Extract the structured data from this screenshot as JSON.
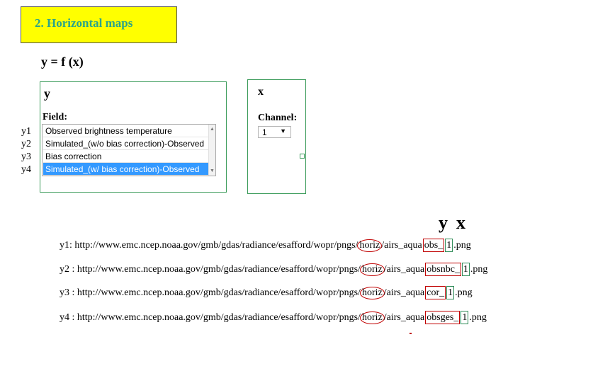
{
  "header": {
    "title": "2. Horizontal maps"
  },
  "formula": "y = f (x)",
  "y_panel": {
    "title": "y",
    "field_label": "Field:",
    "options": [
      "Observed brightness temperature",
      "Simulated_(w/o bias correction)-Observed",
      "Bias correction",
      "Simulated_(w/ bias correction)-Observed"
    ],
    "selected_index": 3,
    "row_labels": [
      "y1",
      "y2",
      "y3",
      "y4"
    ]
  },
  "x_panel": {
    "title": "x",
    "channel_label": "Channel:",
    "channel_value": "1"
  },
  "yx_labels": {
    "y": "y",
    "x": "x"
  },
  "urls": [
    {
      "prefix": "y1: http://www.emc.ncep.noaa.gov/gmb/gdas/radiance/esafford/wopr/pngs/",
      "dir": "horiz",
      "mid": "/airs_aqua",
      "field": "obs_",
      "channel": "1",
      "suffix": ".png"
    },
    {
      "prefix": "y2 : http://www.emc.ncep.noaa.gov/gmb/gdas/radiance/esafford/wopr/pngs/",
      "dir": "horiz",
      "mid": "/airs_aqua",
      "field": "obsnbc_",
      "channel": "1",
      "suffix": ".png"
    },
    {
      "prefix": "y3 : http://www.emc.ncep.noaa.gov/gmb/gdas/radiance/esafford/wopr/pngs/",
      "dir": "horiz",
      "mid": "/airs_aqua",
      "field": "cor_",
      "channel": "1",
      "suffix": ".png"
    },
    {
      "prefix": "y4 : http://www.emc.ncep.noaa.gov/gmb/gdas/radiance/esafford/wopr/pngs/",
      "dir": "horiz",
      "mid": "/airs_aqua",
      "field": "obsges_",
      "channel": "1",
      "suffix": ".png"
    }
  ]
}
